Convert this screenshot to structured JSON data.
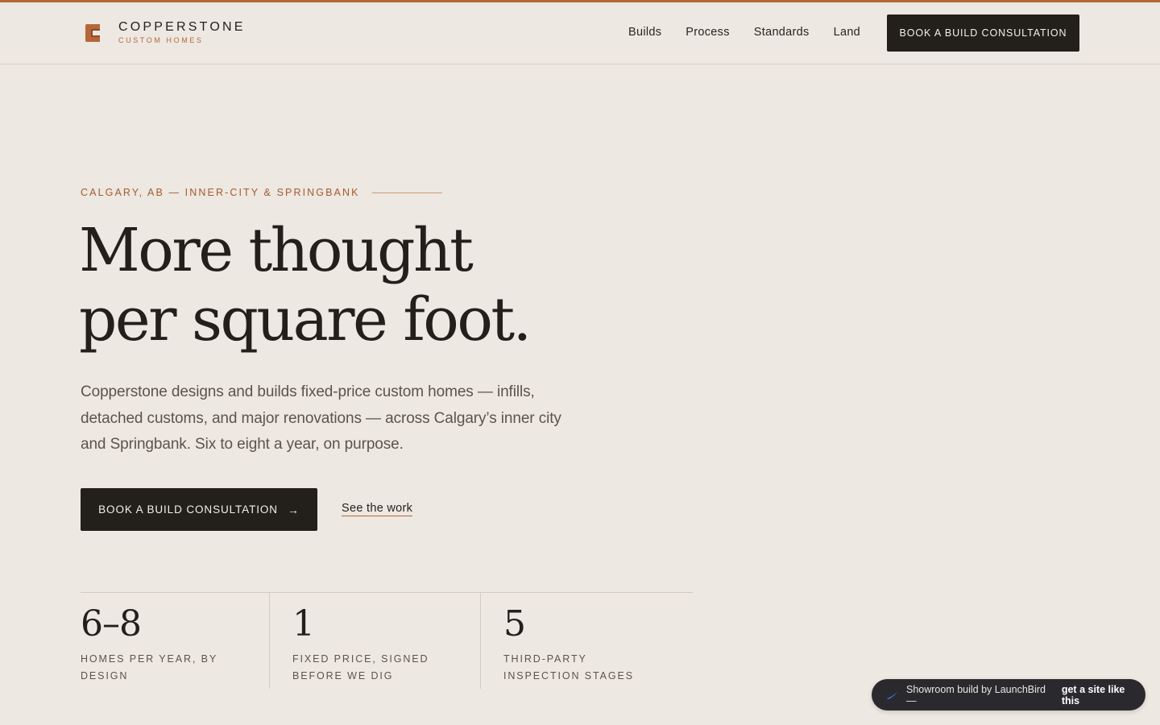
{
  "brand": {
    "name": "COPPERSTONE",
    "tagline": "CUSTOM HOMES",
    "accent": "#b5673a"
  },
  "nav": {
    "items": [
      {
        "label": "Builds"
      },
      {
        "label": "Process"
      },
      {
        "label": "Standards"
      },
      {
        "label": "Land"
      }
    ],
    "cta_label": "BOOK A BUILD CONSULTATION"
  },
  "hero": {
    "eyebrow": "CALGARY, AB — INNER-CITY & SPRINGBANK",
    "headline_line1": "More thought",
    "headline_line2": "per square foot.",
    "lede": "Copperstone designs and builds fixed-price custom homes — infills, detached customs, and major renovations — across Calgary’s inner city and Springbank. Six to eight a year, on purpose.",
    "primary_cta": "BOOK A BUILD CONSULTATION",
    "primary_cta_icon": "arrow-right-icon",
    "secondary_cta": "See the work"
  },
  "stats": [
    {
      "value": "6–8",
      "label": "HOMES PER YEAR, BY DESIGN"
    },
    {
      "value": "1",
      "label": "FIXED PRICE, SIGNED BEFORE WE DIG"
    },
    {
      "value": "5",
      "label": "THIRD-PARTY INSPECTION STAGES"
    }
  ],
  "badge": {
    "text": "Showroom build by LaunchBird —",
    "cta": "get a site like this",
    "icon": "launchbird-icon"
  },
  "colors": {
    "background": "#ede8e1",
    "ink": "#231f1b",
    "copper": "#b5673a",
    "muted": "#5b544d"
  }
}
